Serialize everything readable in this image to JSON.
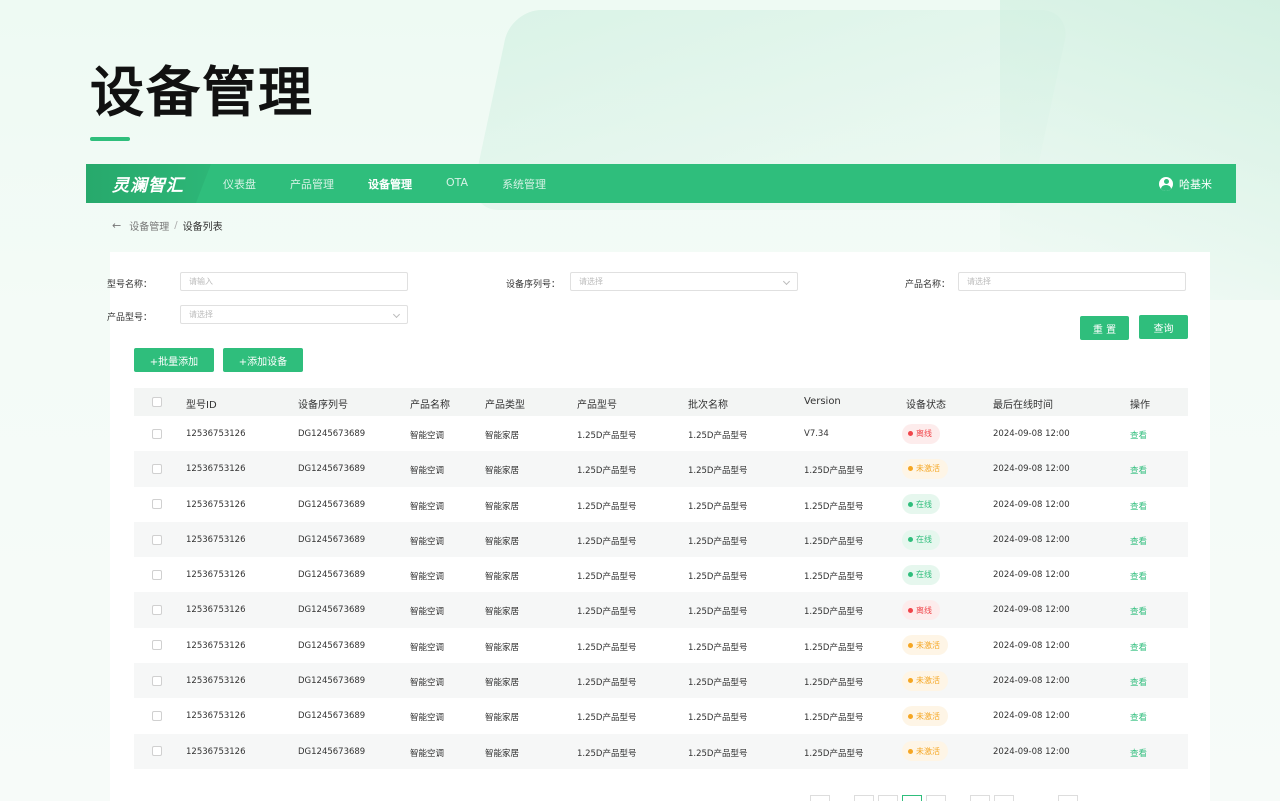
{
  "page_title": "设备管理",
  "nav": {
    "brand": "灵澜智汇",
    "items": [
      {
        "label": "仪表盘",
        "active": false
      },
      {
        "label": "产品管理",
        "active": false
      },
      {
        "label": "设备管理",
        "active": true
      },
      {
        "label": "OTA",
        "active": false
      },
      {
        "label": "系统管理",
        "active": false
      }
    ],
    "user": "哈基米"
  },
  "breadcrumb": {
    "parent": "设备管理",
    "separator": "/",
    "current": "设备列表"
  },
  "filters": {
    "model_name": {
      "label": "型号名称：",
      "placeholder": "请输入"
    },
    "serial": {
      "label": "设备序列号：",
      "placeholder": "请选择"
    },
    "product_name": {
      "label": "产品名称：",
      "placeholder": "请选择"
    },
    "product_model": {
      "label": "产品型号：",
      "placeholder": "请选择"
    }
  },
  "buttons": {
    "reset": "重 置",
    "query": "查询",
    "batch_add": "+批量添加",
    "add_device": "+添加设备"
  },
  "table": {
    "columns": [
      "型号ID",
      "设备序列号",
      "产品名称",
      "产品类型",
      "产品型号",
      "批次名称",
      "Version",
      "设备状态",
      "最后在线时间",
      "操作"
    ],
    "rows": [
      {
        "id": "12536753126",
        "serial": "DG1245673689",
        "name": "智能空调",
        "type": "智能家居",
        "model": "1.25D产品型号",
        "batch": "1.25D产品型号",
        "version": "V7.34",
        "status": "离线",
        "status_kind": "offline",
        "last_online": "2024-09-08 12:00",
        "action": "查看"
      },
      {
        "id": "12536753126",
        "serial": "DG1245673689",
        "name": "智能空调",
        "type": "智能家居",
        "model": "1.25D产品型号",
        "batch": "1.25D产品型号",
        "version": "1.25D产品型号",
        "status": "未激活",
        "status_kind": "inactive",
        "last_online": "2024-09-08 12:00",
        "action": "查看"
      },
      {
        "id": "12536753126",
        "serial": "DG1245673689",
        "name": "智能空调",
        "type": "智能家居",
        "model": "1.25D产品型号",
        "batch": "1.25D产品型号",
        "version": "1.25D产品型号",
        "status": "在线",
        "status_kind": "online",
        "last_online": "2024-09-08 12:00",
        "action": "查看"
      },
      {
        "id": "12536753126",
        "serial": "DG1245673689",
        "name": "智能空调",
        "type": "智能家居",
        "model": "1.25D产品型号",
        "batch": "1.25D产品型号",
        "version": "1.25D产品型号",
        "status": "在线",
        "status_kind": "online",
        "last_online": "2024-09-08 12:00",
        "action": "查看"
      },
      {
        "id": "12536753126",
        "serial": "DG1245673689",
        "name": "智能空调",
        "type": "智能家居",
        "model": "1.25D产品型号",
        "batch": "1.25D产品型号",
        "version": "1.25D产品型号",
        "status": "在线",
        "status_kind": "online",
        "last_online": "2024-09-08 12:00",
        "action": "查看"
      },
      {
        "id": "12536753126",
        "serial": "DG1245673689",
        "name": "智能空调",
        "type": "智能家居",
        "model": "1.25D产品型号",
        "batch": "1.25D产品型号",
        "version": "1.25D产品型号",
        "status": "离线",
        "status_kind": "offline",
        "last_online": "2024-09-08 12:00",
        "action": "查看"
      },
      {
        "id": "12536753126",
        "serial": "DG1245673689",
        "name": "智能空调",
        "type": "智能家居",
        "model": "1.25D产品型号",
        "batch": "1.25D产品型号",
        "version": "1.25D产品型号",
        "status": "未激活",
        "status_kind": "inactive",
        "last_online": "2024-09-08 12:00",
        "action": "查看"
      },
      {
        "id": "12536753126",
        "serial": "DG1245673689",
        "name": "智能空调",
        "type": "智能家居",
        "model": "1.25D产品型号",
        "batch": "1.25D产品型号",
        "version": "1.25D产品型号",
        "status": "未激活",
        "status_kind": "inactive",
        "last_online": "2024-09-08 12:00",
        "action": "查看"
      },
      {
        "id": "12536753126",
        "serial": "DG1245673689",
        "name": "智能空调",
        "type": "智能家居",
        "model": "1.25D产品型号",
        "batch": "1.25D产品型号",
        "version": "1.25D产品型号",
        "status": "未激活",
        "status_kind": "inactive",
        "last_online": "2024-09-08 12:00",
        "action": "查看"
      },
      {
        "id": "12536753126",
        "serial": "DG1245673689",
        "name": "智能空调",
        "type": "智能家居",
        "model": "1.25D产品型号",
        "batch": "1.25D产品型号",
        "version": "1.25D产品型号",
        "status": "未激活",
        "status_kind": "inactive",
        "last_online": "2024-09-08 12:00",
        "action": "查看"
      }
    ]
  },
  "status_colors": {
    "offline": {
      "fg": "#f0454a",
      "bg": "#fdecec"
    },
    "inactive": {
      "fg": "#f5a623",
      "bg": "#fef5e6"
    },
    "online": {
      "fg": "#2fbe7c",
      "bg": "#e6f7ee"
    }
  },
  "accent": "#2fbe7c"
}
